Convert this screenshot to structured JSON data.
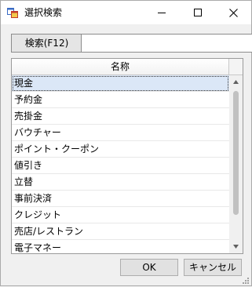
{
  "window": {
    "title": "選択検索",
    "icons": {
      "app": "app-window-icon",
      "minimize": "minimize-icon",
      "maximize": "maximize-icon",
      "close": "close-icon"
    }
  },
  "search": {
    "label": "検索(F12)",
    "value": "",
    "placeholder": ""
  },
  "grid": {
    "header": "名称",
    "selected_index": 0,
    "rows": [
      "現金",
      "予約金",
      "売掛金",
      "バウチャー",
      "ポイント・クーポン",
      "値引き",
      "立替",
      "事前決済",
      "クレジット",
      "売店/レストラン",
      "電子マネー"
    ],
    "scroll_fraction": 0.0
  },
  "buttons": {
    "ok": "OK",
    "cancel": "キャンセル"
  },
  "colors": {
    "selection": "#dbe7f7",
    "window_bg": "#f0f0f0",
    "border": "#9a9a9a"
  }
}
